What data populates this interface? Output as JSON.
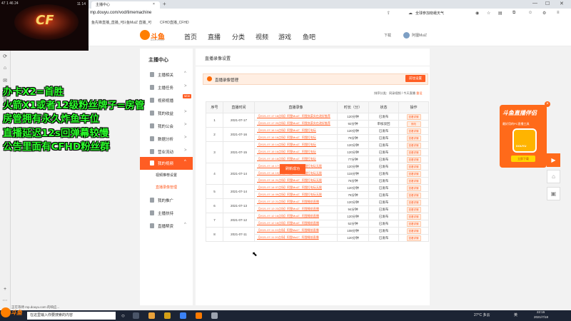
{
  "browser": {
    "tab_title": "主播中心",
    "new_tab": "+",
    "url": "mp.douyu.com/vod/timemachine",
    "weather": "全球参加晓峨天气",
    "bookmarks": [
      "鱼先锋直播_直播_可",
      "斗鱼MuiZ 直播_可",
      "CFHD直播_CFHD"
    ],
    "window_controls": [
      "—",
      "☐",
      "✕"
    ]
  },
  "webcam": {
    "logo_text": "CF",
    "left_info": "47 1 46 24",
    "right_info": "11 14"
  },
  "site": {
    "logo": "斗鱼",
    "logo_sub": "DOUYU.COM",
    "nav": [
      "首页",
      "直播",
      "分类",
      "视频",
      "游戏",
      "鱼吧"
    ],
    "download": "下载",
    "username": "阿狸MuiZ"
  },
  "menu": {
    "title": "主播中心",
    "items": [
      {
        "label": "主播相关",
        "arrow": "^"
      },
      {
        "label": "主播任务",
        "arrow": ">"
      },
      {
        "label": "视频视播",
        "arrow": ""
      },
      {
        "label": "我的收益",
        "arrow": ">"
      },
      {
        "label": "我的公会",
        "arrow": ">"
      },
      {
        "label": "数据分析",
        "arrow": ">"
      },
      {
        "label": "营业流动",
        "arrow": ">"
      },
      {
        "label": "我的视频",
        "arrow": "^"
      },
      {
        "label": "我的推广",
        "arrow": ""
      },
      {
        "label": "主播扶持",
        "arrow": ""
      },
      {
        "label": "直播帮资",
        "arrow": "^"
      }
    ],
    "new_badge": "NEW",
    "sub_items": [
      "视频推荐设置",
      "直播录像管理"
    ]
  },
  "main": {
    "page_title": "直播录像设置",
    "section_label": "直播录像管理",
    "settings_button": "前往设置",
    "sort_prefix": "排序分类：",
    "sort_options": "同录视频 / 今天直播",
    "sort_link": "重设",
    "toast": "刷新成功",
    "headers": [
      "序号",
      "直播时间",
      "直播录像",
      "时长（分）",
      "状态",
      "操作"
    ],
    "rows": [
      {
        "no": "1",
        "date": "2021-07-17",
        "videos": [
          {
            "title": "【2021-07-17 18点场】阿狸MuiZ：阿狸卖菜实在改好推荐",
            "dur": "120分钟",
            "status": "已发布",
            "op": "查看详情"
          },
          {
            "title": "【2021-07-17 20点场】阿狸MuiZ：阿狸卖菜实在改好推荐",
            "dur": "92分钟",
            "status": "审核驳回",
            "op": "修改"
          }
        ]
      },
      {
        "no": "2",
        "date": "2021-07-16",
        "videos": [
          {
            "title": "【2021-07-16 14点场】阿狸MuiZ：阿狸打电玩",
            "dur": "120分钟",
            "status": "已发布",
            "op": "查看详情"
          },
          {
            "title": "【2021-07-16 16点场】阿狸MuiZ：阿狸打电玩",
            "dur": "79分钟",
            "status": "已发布",
            "op": "查看详情"
          }
        ]
      },
      {
        "no": "3",
        "date": "2021-07-15",
        "videos": [
          {
            "title": "【2021-07-15 14点场】阿狸MuiZ：阿狸打电玩",
            "dur": "120分钟",
            "status": "已发布",
            "op": "查看详情"
          },
          {
            "title": "【2021-07-15 16点场】阿狸MuiZ：阿狸打电玩",
            "dur": "120分钟",
            "status": "已发布",
            "op": "查看详情"
          },
          {
            "title": "【2021-07-15 18点场】阿狸MuiZ：阿狸打电玩",
            "dur": "77分钟",
            "status": "已发布",
            "op": "查看详情"
          }
        ]
      },
      {
        "no": "4",
        "date": "2021-07-14",
        "videos": [
          {
            "title": "【2021-07-14 17点场】阿狸MuiZ：阿狸打电玩无限",
            "dur": "120分钟",
            "status": "已发布",
            "op": "查看详情"
          },
          {
            "title": "【2021-07-14 19点场】阿狸MuiZ：阿狸打电玩无限",
            "dur": "115分钟",
            "status": "已发布",
            "op": "查看详情"
          },
          {
            "title": "【2021-07-14 21点场】阿狸MuiZ：阿狸打电玩无限",
            "dur": "76分钟",
            "status": "已发布",
            "op": "查看详情"
          }
        ]
      },
      {
        "no": "5",
        "date": "2021-07-14",
        "videos": [
          {
            "title": "【2021-07-14 07点场】阿狸MuiZ：阿狸打电玩无限",
            "dur": "120分钟",
            "status": "已发布",
            "op": "查看详情"
          },
          {
            "title": "【2021-07-14 09点场】阿狸MuiZ：阿狸打电玩无限",
            "dur": "78分钟",
            "status": "已发布",
            "op": "查看详情"
          }
        ]
      },
      {
        "no": "6",
        "date": "2021-07-13",
        "videos": [
          {
            "title": "【2021-07-13 21点场】阿狸MuiZ：阿狸睡前直播",
            "dur": "120分钟",
            "status": "已发布",
            "op": "查看详情"
          },
          {
            "title": "【2021-07-13 23点场】阿狸MuiZ：阿狸睡前直播",
            "dur": "94分钟",
            "status": "已发布",
            "op": "查看详情"
          }
        ]
      },
      {
        "no": "7",
        "date": "2021-07-12",
        "videos": [
          {
            "title": "【2021-07-12 16点场】阿狸MuiZ：阿狸睡前直播",
            "dur": "120分钟",
            "status": "已发布",
            "op": "查看详情"
          },
          {
            "title": "【2021-07-12 18点场】阿狸MuiZ：阿狸睡前直播",
            "dur": "52分钟",
            "status": "已发布",
            "op": "查看详情"
          }
        ]
      },
      {
        "no": "8",
        "date": "2021-07-11",
        "videos": [
          {
            "title": "【2021-07-11 22点场】阿狸MuiZ：阿狸睡前直播",
            "dur": "108分钟",
            "status": "已发布",
            "op": "查看详情"
          },
          {
            "title": "【2021-07-11 20点场】阿狸MuiZ：阿狸睡前直播",
            "dur": "120分钟",
            "status": "已发布",
            "op": "查看详情"
          }
        ]
      }
    ]
  },
  "ad": {
    "title": "斗鱼直播伴侣",
    "desc": "最好用的PC直播工具",
    "brand": "DOUYU",
    "download": "立即下载",
    "close": "×"
  },
  "overlay_captions": [
    "办卡X2=首胜",
    "火箭X1或者12级粉丝牌子=房管",
    "房管拥有永久炸鱼车位",
    "直播延迟12s回弹幕较慢",
    "公告里面有CFHD粉丝群"
  ],
  "status_line": "正在等待 mp.douyu.com 的响应...",
  "taskbar": {
    "logo": "斗鱼",
    "search_placeholder": "在这里输入你要搜索的内容",
    "weather": "27°C 多云",
    "lang": "英",
    "time": "22:15",
    "date": "2021/7/18"
  },
  "colors": {
    "accent": "#ff5d23",
    "caption": "#2cff2c",
    "taskbar": "#1c2434"
  }
}
